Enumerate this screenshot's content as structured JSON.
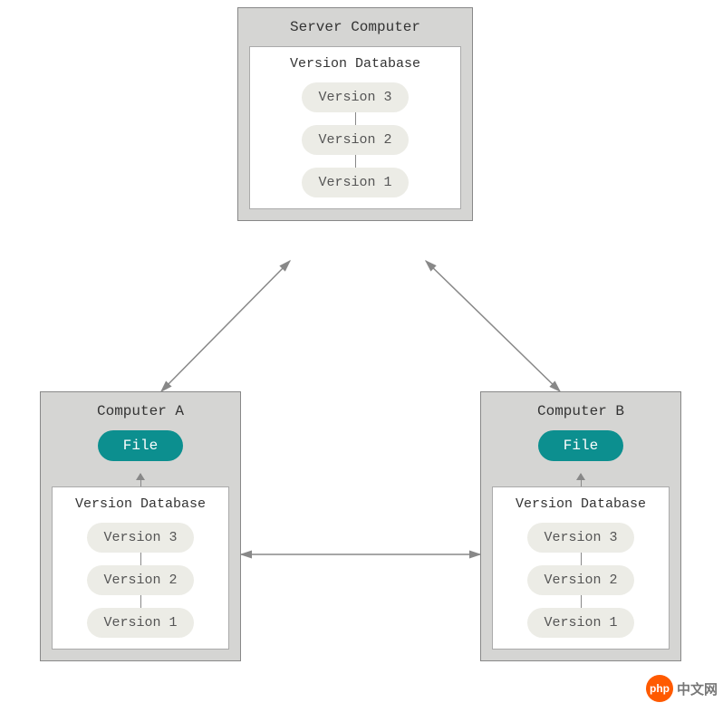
{
  "server": {
    "title": "Server Computer",
    "database": {
      "title": "Version Database",
      "versions": [
        "Version 3",
        "Version 2",
        "Version 1"
      ]
    }
  },
  "computerA": {
    "title": "Computer A",
    "file_label": "File",
    "database": {
      "title": "Version Database",
      "versions": [
        "Version 3",
        "Version 2",
        "Version 1"
      ]
    }
  },
  "computerB": {
    "title": "Computer B",
    "file_label": "File",
    "database": {
      "title": "Version Database",
      "versions": [
        "Version 3",
        "Version 2",
        "Version 1"
      ]
    }
  },
  "watermark": {
    "logo_text": "php",
    "site_text": "中文网"
  }
}
